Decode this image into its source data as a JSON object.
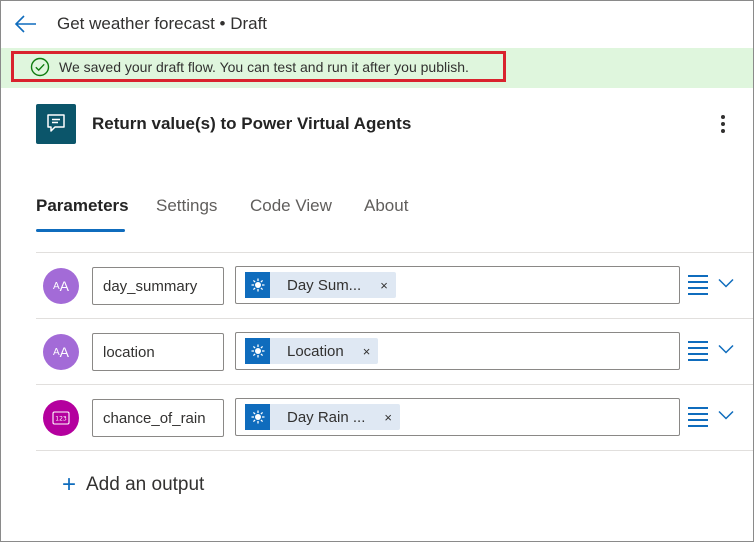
{
  "header": {
    "title": "Get weather forecast • Draft"
  },
  "banner": {
    "message": "We saved your draft flow. You can test and run it after you publish."
  },
  "action": {
    "title": "Return value(s) to Power Virtual Agents"
  },
  "tabs": [
    {
      "label": "Parameters",
      "active": true
    },
    {
      "label": "Settings",
      "active": false
    },
    {
      "label": "Code View",
      "active": false
    },
    {
      "label": "About",
      "active": false
    }
  ],
  "outputs": [
    {
      "type_icon": "text-type-icon",
      "type_label": "AA",
      "name": "day_summary",
      "token_icon": "weather-sun-icon",
      "token_label": "Day Sum...",
      "remove": "×"
    },
    {
      "type_icon": "text-type-icon",
      "type_label": "AA",
      "name": "location",
      "token_icon": "weather-sun-icon",
      "token_label": "Location",
      "remove": "×"
    },
    {
      "type_icon": "number-type-icon",
      "type_label": "123",
      "name": "chance_of_rain",
      "token_icon": "weather-sun-icon",
      "token_label": "Day Rain ...",
      "remove": "×"
    }
  ],
  "add_output": {
    "label": "Add an output",
    "icon": "+"
  },
  "colors": {
    "accent": "#0f6cbd",
    "banner_bg": "#dff6dd",
    "highlight_border": "#d9232e",
    "action_icon_bg": "#0b556a",
    "text_avatar": "#a36bd7",
    "number_avatar": "#b4009e"
  }
}
